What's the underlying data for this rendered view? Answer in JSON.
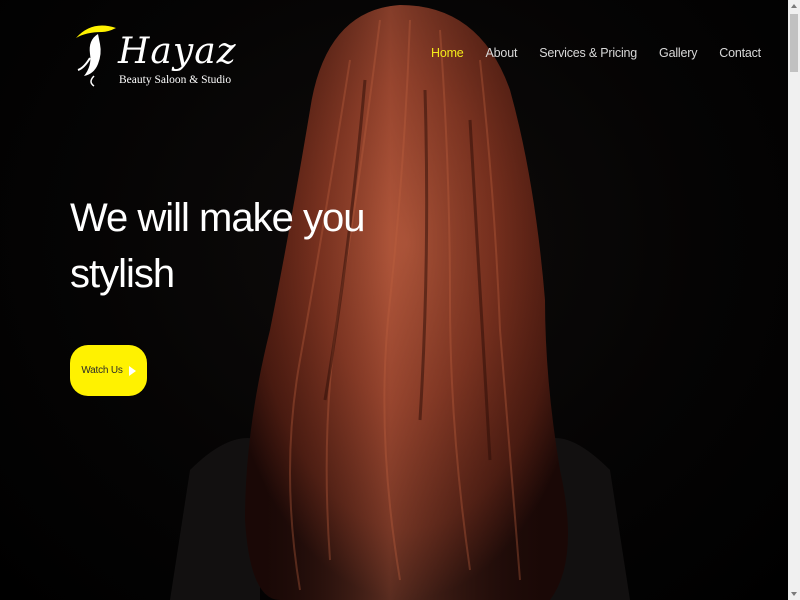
{
  "brand": {
    "name": "Hayaz",
    "tagline": "Beauty Saloon & Studio",
    "accent_color": "#fff200",
    "logo_icon": "woman-hat-icon"
  },
  "nav": {
    "items": [
      {
        "label": "Home",
        "active": true
      },
      {
        "label": "About",
        "active": false
      },
      {
        "label": "Services & Pricing",
        "active": false
      },
      {
        "label": "Gallery",
        "active": false
      },
      {
        "label": "Contact",
        "active": false
      }
    ]
  },
  "hero": {
    "headline_line1": "We will make you",
    "headline_line2": "stylish",
    "cta_label": "Watch Us",
    "cta_icon": "play-icon",
    "background_image": "woman-long-red-hair-back-view"
  }
}
